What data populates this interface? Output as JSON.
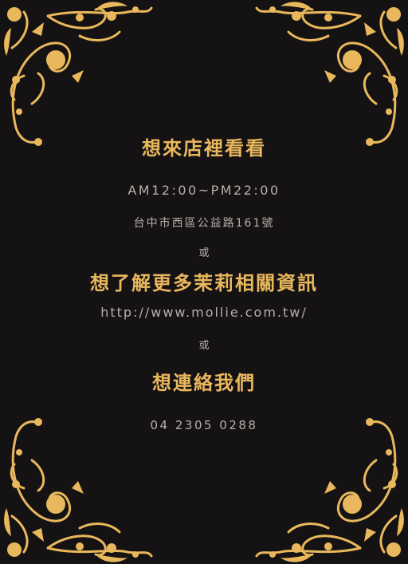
{
  "colors": {
    "background": "#151214",
    "accent_gold": "#e9b85c",
    "text_muted": "#b7b0a8"
  },
  "ornament": "gold-filigree-corner-icon",
  "visit": {
    "title": "想來店裡看看",
    "hours": "AM12:00~PM22:00",
    "address": "台中市西區公益路161號"
  },
  "separator_1": "或",
  "more_info": {
    "title": "想了解更多茉莉相關資訊",
    "url": "http://www.mollie.com.tw/"
  },
  "separator_2": "或",
  "contact": {
    "title": "想連絡我們",
    "phone": "04 2305 0288"
  }
}
